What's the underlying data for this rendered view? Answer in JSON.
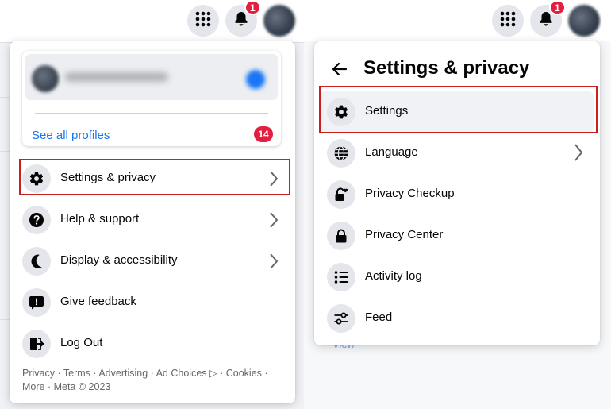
{
  "colors": {
    "accent": "#1877f2",
    "badge": "#e41e3f",
    "highlight": "#c81f1f",
    "icon_bg": "#e4e6eb"
  },
  "left": {
    "topbar": {
      "menu_icon": "grid-menu-icon",
      "notifications_icon": "bell-icon",
      "notifications_count": "1"
    },
    "profile_card": {
      "see_all_label": "See all profiles",
      "profiles_count": "14"
    },
    "menu_items": [
      {
        "label": "Settings & privacy",
        "icon": "gear-icon",
        "has_chevron": true
      },
      {
        "label": "Help & support",
        "icon": "help-icon",
        "has_chevron": true
      },
      {
        "label": "Display & accessibility",
        "icon": "moon-icon",
        "has_chevron": true
      },
      {
        "label": "Give feedback",
        "icon": "feedback-icon",
        "has_chevron": false
      },
      {
        "label": "Log Out",
        "icon": "logout-icon",
        "has_chevron": false
      }
    ],
    "footer": {
      "links": [
        "Privacy",
        "Terms",
        "Advertising",
        "Ad Choices",
        "Cookies",
        "More"
      ],
      "copyright": "Meta © 2023"
    }
  },
  "right": {
    "topbar": {
      "menu_icon": "grid-menu-icon",
      "notifications_icon": "bell-icon",
      "notifications_count": "1"
    },
    "panel": {
      "title": "Settings & privacy",
      "back_icon": "back-arrow-icon",
      "items": [
        {
          "label": "Settings",
          "icon": "gear-icon",
          "has_chevron": false
        },
        {
          "label": "Language",
          "icon": "globe-icon",
          "has_chevron": true
        },
        {
          "label": "Privacy Checkup",
          "icon": "lock-heart-icon",
          "has_chevron": false
        },
        {
          "label": "Privacy Center",
          "icon": "lock-icon",
          "has_chevron": false
        },
        {
          "label": "Activity log",
          "icon": "list-icon",
          "has_chevron": false
        },
        {
          "label": "Feed",
          "icon": "sliders-icon",
          "has_chevron": false
        }
      ]
    },
    "background_link": "View"
  }
}
